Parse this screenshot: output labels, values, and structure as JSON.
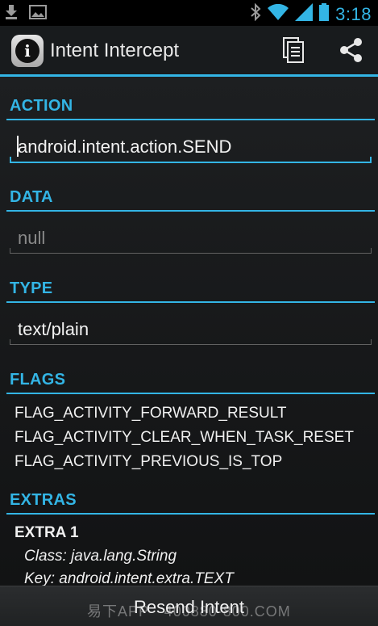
{
  "status": {
    "time": "3:18",
    "icons": [
      "download-icon",
      "image-icon",
      "bluetooth-icon",
      "wifi-icon",
      "signal-icon",
      "battery-icon"
    ]
  },
  "actionbar": {
    "title": "Intent Intercept",
    "app_icon_glyph": "i",
    "actions": [
      "copy-icon",
      "share-icon"
    ]
  },
  "sections": {
    "action": {
      "header": "ACTION",
      "value": "android.intent.action.SEND"
    },
    "data": {
      "header": "DATA",
      "value": "null"
    },
    "type": {
      "header": "TYPE",
      "value": "text/plain"
    },
    "flags": {
      "header": "FLAGS",
      "items": [
        "FLAG_ACTIVITY_FORWARD_RESULT",
        "FLAG_ACTIVITY_CLEAR_WHEN_TASK_RESET",
        "FLAG_ACTIVITY_PREVIOUS_IS_TOP"
      ]
    },
    "extras": {
      "header": "EXTRAS",
      "extra_title": "EXTRA 1",
      "class_line": "Class: java.lang.String",
      "key_line": "Key: android.intent.extra.TEXT"
    }
  },
  "bottom": {
    "button_label": "Resend Intent"
  },
  "watermark": "易下APP　400880·800.COM",
  "colors": {
    "accent": "#33b5e5",
    "background": "#000000"
  }
}
